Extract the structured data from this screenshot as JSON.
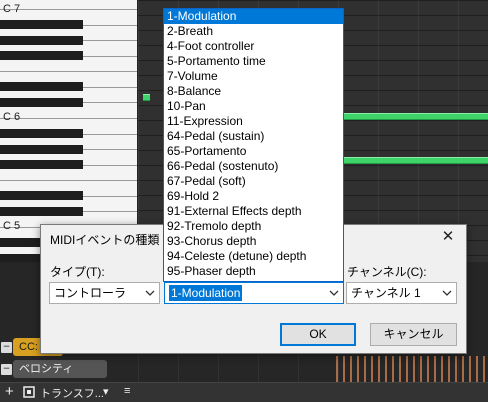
{
  "piano_roll": {
    "octave_labels": [
      "C 7",
      "C 6",
      "C 5"
    ],
    "note_color": "#3fd46a"
  },
  "lanes": {
    "cc_tab_label": "CC:",
    "velocity_tab_label": "ベロシティ",
    "cc_tab_color": "#d8a020",
    "velocity_tab_color": "#555555"
  },
  "toolbar": {
    "transform_label": "トランスフ...",
    "dropdown_glyph": "▾",
    "menu_glyph": "≡"
  },
  "dialog": {
    "title": "MIDIイベントの種類",
    "close_glyph": "✕",
    "type_label": "タイプ(T):",
    "type_value": "コントローラ",
    "event_value": "1-Modulation",
    "channel_label": "チャンネル(C):",
    "channel_value": "チャンネル 1",
    "ok_label": "OK",
    "cancel_label": "キャンセル"
  },
  "dropdown": {
    "selected_index": 0,
    "items": [
      "1-Modulation",
      "2-Breath",
      "4-Foot controller",
      "5-Portamento time",
      "7-Volume",
      "8-Balance",
      "10-Pan",
      "11-Expression",
      "64-Pedal (sustain)",
      "65-Portamento",
      "66-Pedal (sostenuto)",
      "67-Pedal (soft)",
      "69-Hold 2",
      "91-External Effects depth",
      "92-Tremolo depth",
      "93-Chorus depth",
      "94-Celeste (detune) depth",
      "95-Phaser depth"
    ]
  }
}
